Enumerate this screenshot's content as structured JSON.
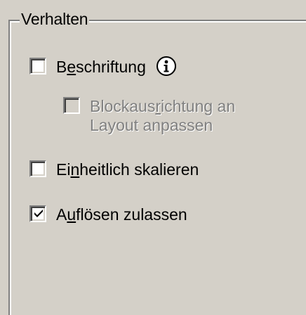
{
  "group": {
    "legend": "Verhalten"
  },
  "options": {
    "annotative": {
      "label_pre": "B",
      "label_mnemonic": "e",
      "label_post": "schriftung",
      "checked": false,
      "enabled": true,
      "info_icon": "info-icon"
    },
    "match_orientation": {
      "label_pre": "Blockaus",
      "label_mnemonic": "r",
      "label_post": "ichtung an",
      "label_line2": "Layout anpassen",
      "checked": false,
      "enabled": false
    },
    "scale_uniformly": {
      "label_pre": "Ei",
      "label_mnemonic": "n",
      "label_post": "heitlich skalieren",
      "checked": false,
      "enabled": true
    },
    "allow_exploding": {
      "label_pre": "A",
      "label_mnemonic": "u",
      "label_post": "flösen zulassen",
      "checked": true,
      "enabled": true
    }
  },
  "colors": {
    "face": "#d4d0c8",
    "shadow": "#808080",
    "highlight": "#ffffff",
    "disabled_text": "#808080"
  }
}
